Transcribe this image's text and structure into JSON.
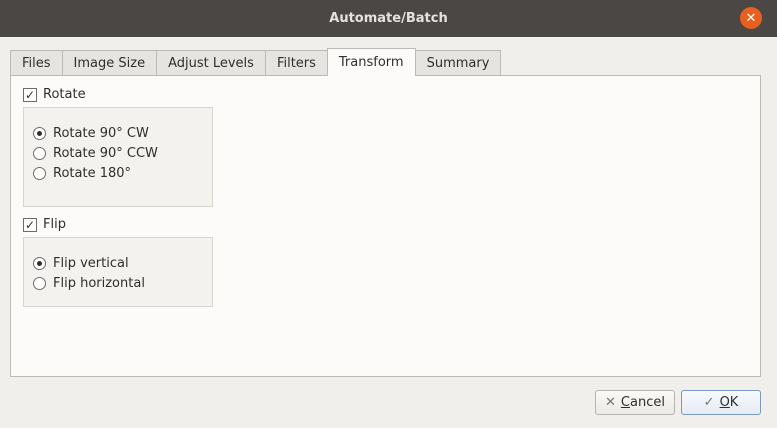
{
  "window": {
    "title": "Automate/Batch"
  },
  "tabs": [
    {
      "label": "Files"
    },
    {
      "label": "Image Size"
    },
    {
      "label": "Adjust Levels"
    },
    {
      "label": "Filters"
    },
    {
      "label": "Transform",
      "active": true
    },
    {
      "label": "Summary"
    }
  ],
  "rotate": {
    "label": "Rotate",
    "checked": true,
    "options": [
      {
        "label": "Rotate 90° CW",
        "selected": true
      },
      {
        "label": "Rotate 90° CCW",
        "selected": false
      },
      {
        "label": "Rotate 180°",
        "selected": false
      }
    ]
  },
  "flip": {
    "label": "Flip",
    "checked": true,
    "options": [
      {
        "label": "Flip vertical",
        "selected": true
      },
      {
        "label": "Flip horizontal",
        "selected": false
      }
    ]
  },
  "buttons": {
    "cancel": {
      "mnemonic": "C",
      "rest": "ancel",
      "icon": "✕"
    },
    "ok": {
      "mnemonic": "O",
      "rest": "K",
      "icon": "✓"
    }
  },
  "colors": {
    "accent": "#e95f20",
    "titlebar": "#4a4745"
  }
}
